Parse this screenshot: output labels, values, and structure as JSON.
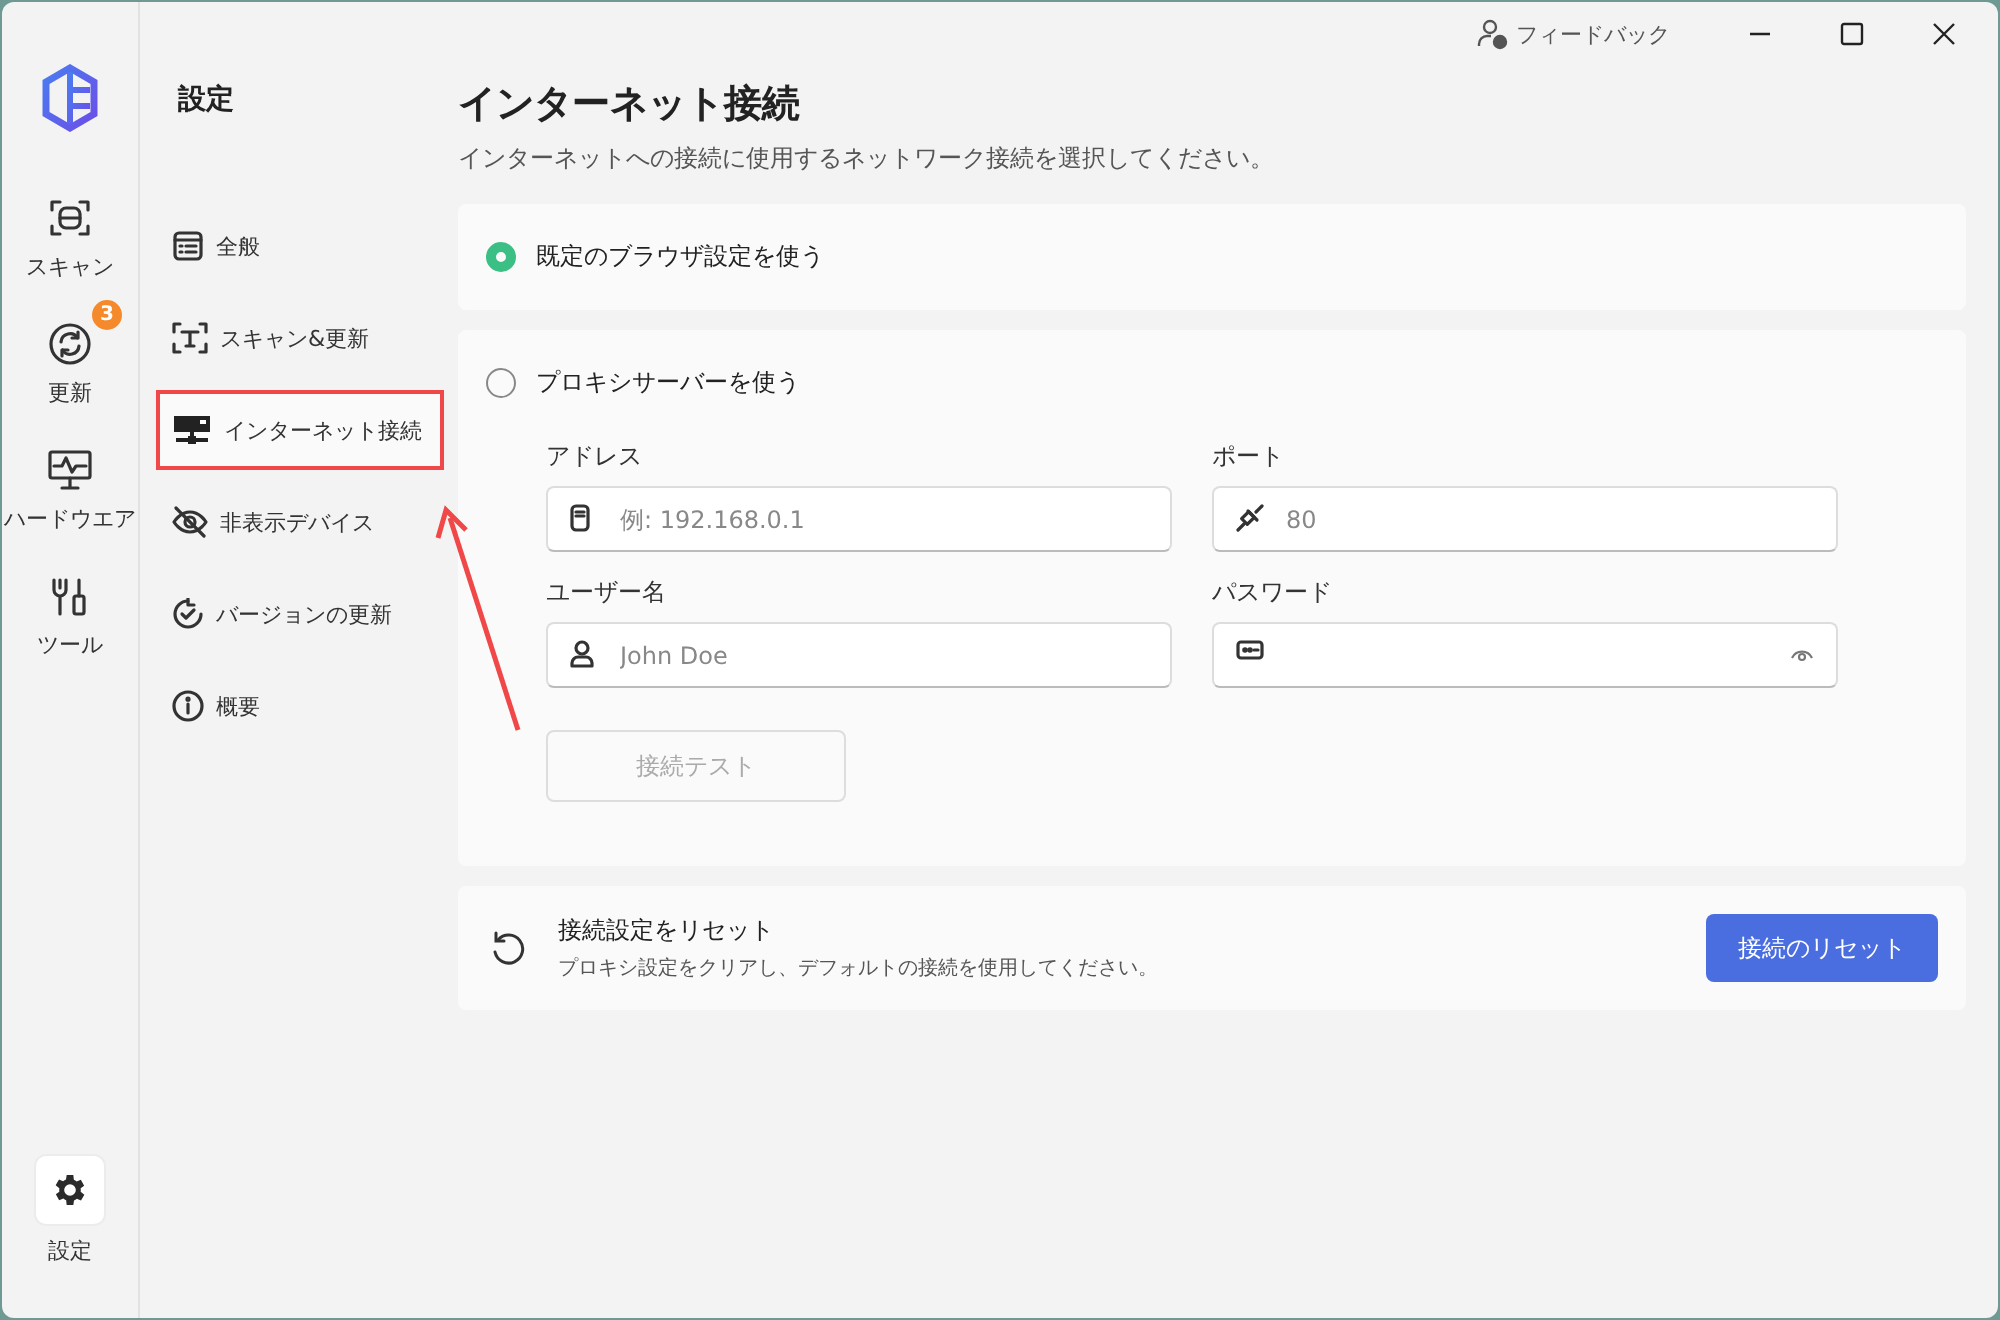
{
  "title_bar": {
    "feedback": "フィードバック"
  },
  "rail": {
    "items": [
      {
        "label": "スキャン",
        "selected": false
      },
      {
        "label": "更新",
        "badge": "3",
        "selected": false
      },
      {
        "label": "ハードウエア",
        "selected": false
      },
      {
        "label": "ツール",
        "selected": false
      }
    ],
    "bottom": {
      "label": "設定",
      "selected": true
    }
  },
  "sidebar": {
    "title": "設定",
    "items": [
      {
        "label": "全般",
        "selected": false
      },
      {
        "label": "スキャン&更新",
        "selected": false
      },
      {
        "label": "インターネット接続",
        "selected": true
      },
      {
        "label": "非表示デバイス",
        "selected": false
      },
      {
        "label": "バージョンの更新",
        "selected": false
      },
      {
        "label": "概要",
        "selected": false
      }
    ]
  },
  "page": {
    "title": "インターネット接続",
    "subtitle": "インターネットへの接続に使用するネットワーク接続を選択してください。"
  },
  "options": [
    {
      "label": "既定のブラウザ設定を使う",
      "selected": true
    },
    {
      "label": "プロキシサーバーを使う",
      "selected": false
    }
  ],
  "proxy": {
    "fields": [
      {
        "label": "アドレス",
        "kind": "text",
        "placeholder": "例: 192.168.0.1"
      },
      {
        "label": "ポート",
        "kind": "text",
        "placeholder": "80"
      },
      {
        "label": "ユーザー名",
        "kind": "text",
        "placeholder": "John Doe"
      },
      {
        "label": "パスワード",
        "kind": "password"
      }
    ],
    "test_button": {
      "label": "接続テスト",
      "disabled": true
    }
  },
  "reset": {
    "title": "接続設定をリセット",
    "description": "プロキシ設定をクリアし、デフォルトの接続を使用してください。",
    "button": "接続のリセット"
  }
}
